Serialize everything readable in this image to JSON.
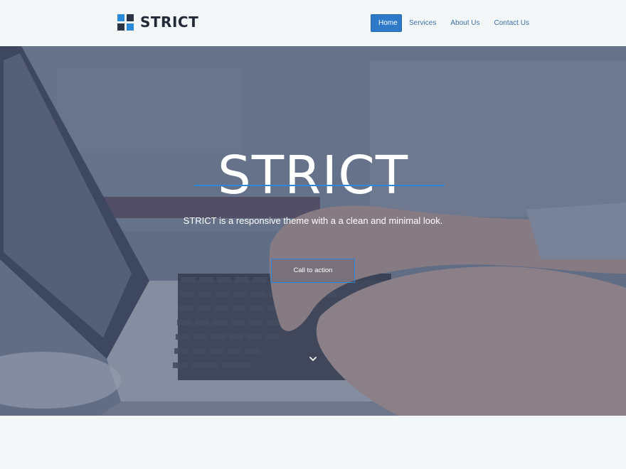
{
  "brand": {
    "name": "STRICT",
    "logo_colors": {
      "accent": "#2a8bdc",
      "dark": "#2b3445"
    }
  },
  "nav": {
    "items": [
      {
        "label": "Home",
        "active": true
      },
      {
        "label": "Services",
        "active": false
      },
      {
        "label": "About Us",
        "active": false
      },
      {
        "label": "Contact Us",
        "active": false
      }
    ]
  },
  "hero": {
    "title": "STRICT",
    "subtitle": "STRICT is a responsive theme with a a clean and minimal look.",
    "cta_label": "Call to action",
    "scroll_icon": "chevron-down-icon",
    "accent_color": "#2f86d6"
  }
}
